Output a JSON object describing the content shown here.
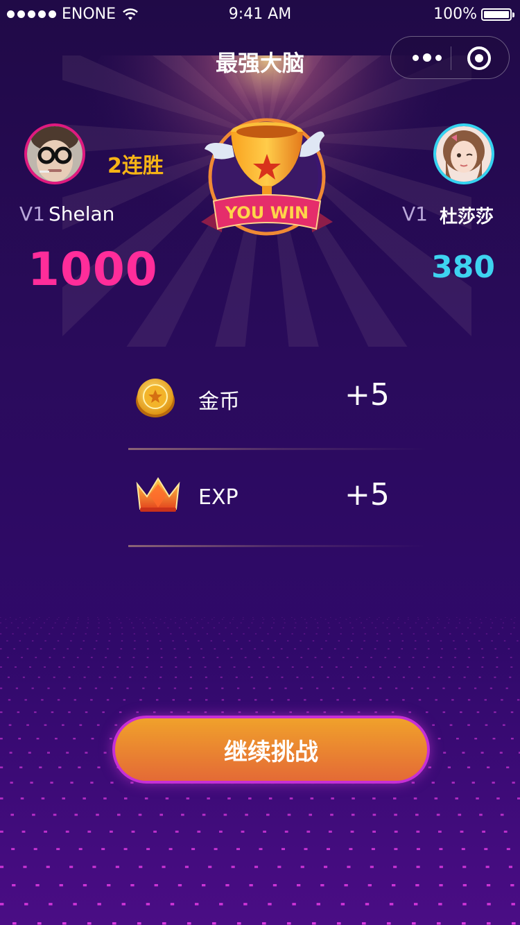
{
  "status_bar": {
    "carrier": "ENONE",
    "time": "9:41 AM",
    "battery": "100%",
    "battery_level": 1.0,
    "signal_icon": "signal-dots-icon",
    "wifi_icon": "wifi-icon"
  },
  "nav": {
    "title": "最强大脑",
    "more_icon": "more-icon",
    "close_icon": "target-close-icon"
  },
  "player1": {
    "level": "V1",
    "name": "Shelan",
    "streak": "2连胜",
    "score": "1000",
    "ring_color": "#e01a7f"
  },
  "player2": {
    "level": "V1",
    "name": "杜莎莎",
    "score": "380",
    "ring_color": "#35d3f0"
  },
  "trophy": {
    "banner_text": "YOU WIN"
  },
  "rewards": [
    {
      "icon": "coin-icon",
      "label": "金币",
      "value": "+5"
    },
    {
      "icon": "crown-icon",
      "label": "EXP",
      "value": "+5"
    }
  ],
  "actions": {
    "continue_label": "继续挑战"
  },
  "colors": {
    "accent_pink": "#ff2d9a",
    "accent_cyan": "#3ed3f0",
    "streak_gold": "#f6b416",
    "button_top": "#f0a12b",
    "button_bottom": "#e46a36"
  }
}
